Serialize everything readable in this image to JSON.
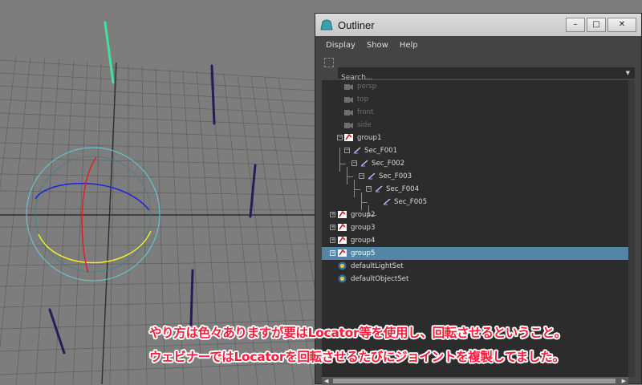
{
  "window": {
    "title": "Outliner",
    "minimize_icon": "minimize-icon",
    "maximize_icon": "maximize-icon",
    "close_icon": "close-icon"
  },
  "menu": [
    "Display",
    "Show",
    "Help"
  ],
  "search": {
    "placeholder": "Search..."
  },
  "tree": [
    {
      "label": "persp",
      "icon": "camera-icon",
      "dim": true
    },
    {
      "label": "top",
      "icon": "camera-icon",
      "dim": true
    },
    {
      "label": "front",
      "icon": "camera-icon",
      "dim": true
    },
    {
      "label": "side",
      "icon": "camera-icon",
      "dim": true
    },
    {
      "label": "group1",
      "icon": "group-icon",
      "expanded": true
    },
    {
      "label": "Sec_F001",
      "icon": "joint-icon",
      "expanded": true
    },
    {
      "label": "Sec_F002",
      "icon": "joint-icon",
      "expanded": true
    },
    {
      "label": "Sec_F003",
      "icon": "joint-icon",
      "expanded": true
    },
    {
      "label": "Sec_F004",
      "icon": "joint-icon",
      "expanded": true
    },
    {
      "label": "Sec_F005",
      "icon": "joint-icon"
    },
    {
      "label": "group2",
      "icon": "group-icon",
      "expanded": false
    },
    {
      "label": "group3",
      "icon": "group-icon",
      "expanded": false
    },
    {
      "label": "group4",
      "icon": "group-icon",
      "expanded": false
    },
    {
      "label": "group5",
      "icon": "group-icon",
      "expanded": false,
      "selected": true
    },
    {
      "label": "defaultLightSet",
      "icon": "set-icon"
    },
    {
      "label": "defaultObjectSet",
      "icon": "set-icon"
    }
  ],
  "caption": {
    "line1": "やり方は色々ありますが要はLocator等を使用し、回転させるということ。",
    "line2": "ウェビナーではLocatorを回転させるたびにジョイントを複製してました。"
  },
  "colors": {
    "selection": "#5285a6",
    "caption_text": "#ff1b3a",
    "sphere_outline": "#5fd0e0",
    "rotate_x": "#e02020",
    "rotate_y": "#f0f020",
    "rotate_z": "#2020e0",
    "selected_joint": "#40e0a0",
    "joint": "#2a1a5a"
  }
}
